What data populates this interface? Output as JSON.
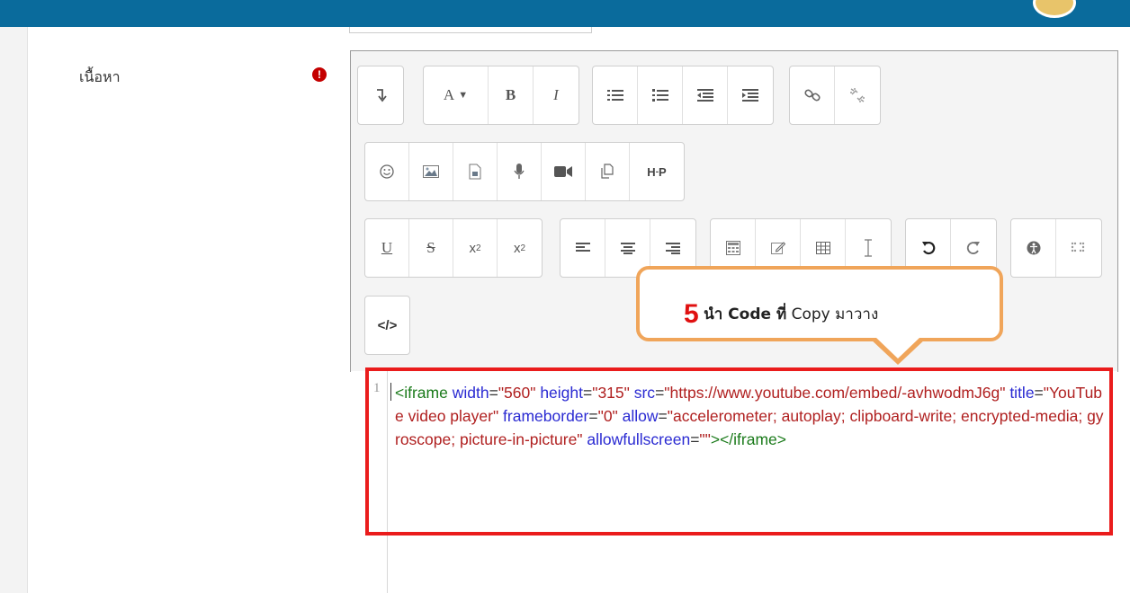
{
  "field": {
    "label": "เนื้อหา",
    "required_icon": "exclamation-circle-icon"
  },
  "toolbar": {
    "row1": [
      {
        "name": "collapse-icon",
        "glyph": "↴"
      },
      {
        "name": "font-size-dropdown",
        "glyph": "A▾"
      },
      {
        "name": "bold",
        "glyph": "B"
      },
      {
        "name": "italic",
        "glyph": "I"
      },
      {
        "name": "unordered-list-icon"
      },
      {
        "name": "ordered-list-icon"
      },
      {
        "name": "outdent-icon"
      },
      {
        "name": "indent-icon"
      },
      {
        "name": "link-icon"
      },
      {
        "name": "unlink-icon"
      }
    ],
    "row2": [
      {
        "name": "emoji-icon"
      },
      {
        "name": "image-icon"
      },
      {
        "name": "media-icon"
      },
      {
        "name": "record-audio-icon"
      },
      {
        "name": "record-video-icon"
      },
      {
        "name": "manage-files-icon"
      },
      {
        "name": "h5p-icon",
        "glyph": "H-P"
      }
    ],
    "row3": [
      {
        "name": "underline",
        "glyph": "U"
      },
      {
        "name": "strikethrough",
        "glyph": "S"
      },
      {
        "name": "subscript",
        "glyph": "x₂"
      },
      {
        "name": "superscript",
        "glyph": "x²"
      },
      {
        "name": "align-left-icon"
      },
      {
        "name": "align-center-icon"
      },
      {
        "name": "align-right-icon"
      },
      {
        "name": "equation-icon"
      },
      {
        "name": "edit-icon"
      },
      {
        "name": "table-icon"
      },
      {
        "name": "clear-formatting-icon"
      },
      {
        "name": "undo-icon"
      },
      {
        "name": "redo-icon"
      },
      {
        "name": "accessibility-icon"
      },
      {
        "name": "braille-icon"
      }
    ],
    "row4": [
      {
        "name": "html-source-icon",
        "glyph": "</>"
      }
    ]
  },
  "editor": {
    "line_number": "1",
    "code_tokens": [
      {
        "t": "tag",
        "s": "<iframe"
      },
      {
        "t": "sp",
        "s": " "
      },
      {
        "t": "attr",
        "s": "width"
      },
      {
        "t": "eq",
        "s": "="
      },
      {
        "t": "val",
        "s": "\"560\""
      },
      {
        "t": "sp",
        "s": " "
      },
      {
        "t": "attr",
        "s": "height"
      },
      {
        "t": "eq",
        "s": "="
      },
      {
        "t": "val",
        "s": "\"315\""
      },
      {
        "t": "sp",
        "s": " "
      },
      {
        "t": "attr",
        "s": "src"
      },
      {
        "t": "eq",
        "s": "="
      },
      {
        "t": "val",
        "s": "\"https://www.youtube.com/embed/-avhwodmJ6g\""
      },
      {
        "t": "sp",
        "s": " "
      },
      {
        "t": "attr",
        "s": "title"
      },
      {
        "t": "eq",
        "s": "="
      },
      {
        "t": "val",
        "s": "\"YouTube video player\""
      },
      {
        "t": "sp",
        "s": " "
      },
      {
        "t": "attr",
        "s": "frameborder"
      },
      {
        "t": "eq",
        "s": "="
      },
      {
        "t": "val",
        "s": "\"0\""
      },
      {
        "t": "sp",
        "s": " "
      },
      {
        "t": "attr",
        "s": "allow"
      },
      {
        "t": "eq",
        "s": "="
      },
      {
        "t": "val",
        "s": "\"accelerometer; autoplay; clipboard-write; encrypted-media; gyroscope; picture-in-picture\""
      },
      {
        "t": "sp",
        "s": " "
      },
      {
        "t": "attr",
        "s": "allowfullscreen"
      },
      {
        "t": "eq",
        "s": "="
      },
      {
        "t": "val",
        "s": "\"\""
      },
      {
        "t": "tag",
        "s": "></iframe>"
      }
    ]
  },
  "callout": {
    "number": "5",
    "text_bold": "นำ Code ที่",
    "text_rest": "Copy มาวาง"
  },
  "colors": {
    "topbar": "#0a6b9c",
    "highlight_box": "#ea1c1c",
    "callout_border": "#f0a55a"
  }
}
